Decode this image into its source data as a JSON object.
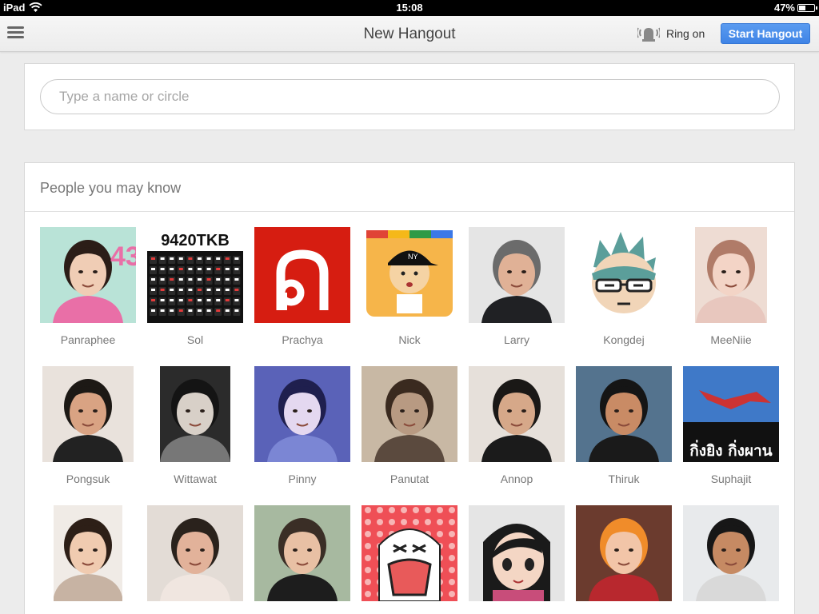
{
  "status_bar": {
    "device": "iPad",
    "time": "15:08",
    "battery": "47%",
    "battery_level": 0.47
  },
  "header": {
    "title": "New Hangout",
    "ring_label": "Ring on",
    "start_button": "Start Hangout",
    "accent_color": "#4a8af4"
  },
  "search": {
    "placeholder": "Type a name or circle",
    "value": ""
  },
  "people": {
    "title": "People you may know",
    "items": [
      {
        "name": "Panraphee",
        "art": "photo",
        "colors": [
          "#b9e3d7",
          "#2b1d17",
          "#f0cdb5",
          "#e96fa7"
        ],
        "avatar_text": "43"
      },
      {
        "name": "Sol",
        "art": "keyboard",
        "colors": [
          "#111111",
          "#ffffff",
          "#e33b3b"
        ],
        "avatar_text": "9420TKB"
      },
      {
        "name": "Prachya",
        "art": "logo",
        "colors": [
          "#d61d11",
          "#ffffff"
        ]
      },
      {
        "name": "Nick",
        "art": "cartoon-cap",
        "colors": [
          "#f6b54a",
          "#111111",
          "#f5d3a4"
        ],
        "avatar_text": "NY"
      },
      {
        "name": "Larry",
        "art": "photo",
        "colors": [
          "#e5e5e5",
          "#6b6b6b",
          "#e0b196",
          "#202124"
        ]
      },
      {
        "name": "Kongdej",
        "art": "cartoon-face",
        "colors": [
          "#ffffff",
          "#5b9e9a",
          "#f1d5b8",
          "#222222"
        ]
      },
      {
        "name": "MeeNiie",
        "art": "photo",
        "colors": [
          "#eedcd3",
          "#b07b68",
          "#f3d4c6",
          "#e8c7be"
        ]
      },
      {
        "name": "Pongsuk",
        "art": "photo",
        "colors": [
          "#e9e2dc",
          "#1d1915",
          "#d9a383",
          "#222222"
        ]
      },
      {
        "name": "Wittawat",
        "art": "photo",
        "colors": [
          "#2b2b2b",
          "#141414",
          "#d8d0c8",
          "#777777"
        ]
      },
      {
        "name": "Pinny",
        "art": "photo",
        "colors": [
          "#5a62b8",
          "#1f1f4e",
          "#e4d8f0",
          "#7b86d4"
        ]
      },
      {
        "name": "Panutat",
        "art": "photo",
        "colors": [
          "#c8b8a4",
          "#3a2a1f",
          "#b89a82",
          "#5b4a3e"
        ]
      },
      {
        "name": "Annop",
        "art": "photo",
        "colors": [
          "#e6e0da",
          "#1a1816",
          "#d6a889",
          "#1b1b1b"
        ]
      },
      {
        "name": "Thiruk",
        "art": "photo",
        "colors": [
          "#54738e",
          "#151515",
          "#c98b65",
          "#1a1a1a"
        ]
      },
      {
        "name": "Suphajit",
        "art": "text-photo",
        "colors": [
          "#3f79c8",
          "#111111",
          "#ffffff"
        ],
        "avatar_text": "กิ่งยิง กิ่งผาน"
      },
      {
        "name": "",
        "art": "photo",
        "colors": [
          "#f0ebe6",
          "#2d1f17",
          "#f0cbb0",
          "#c7b3a3"
        ]
      },
      {
        "name": "",
        "art": "photo",
        "colors": [
          "#e3dcd6",
          "#2a221c",
          "#e2b29a",
          "#f0e6e0"
        ]
      },
      {
        "name": "",
        "art": "photo",
        "colors": [
          "#a7b9a0",
          "#3a2e26",
          "#e8c0a4",
          "#1d1d1d"
        ]
      },
      {
        "name": "",
        "art": "cartoon-sad",
        "colors": [
          "#ef4f56",
          "#ffffff",
          "#e85a5a",
          "#222222"
        ]
      },
      {
        "name": "",
        "art": "cartoon-girl",
        "colors": [
          "#e5e5e5",
          "#1a1a1a",
          "#f4d6c4",
          "#c84d7a"
        ]
      },
      {
        "name": "",
        "art": "photo",
        "colors": [
          "#6b3b2e",
          "#f08c2a",
          "#f2c5a8",
          "#b8282e"
        ]
      },
      {
        "name": "",
        "art": "photo",
        "colors": [
          "#e8eaec",
          "#171717",
          "#c68a63",
          "#d9d9d9"
        ]
      }
    ]
  }
}
